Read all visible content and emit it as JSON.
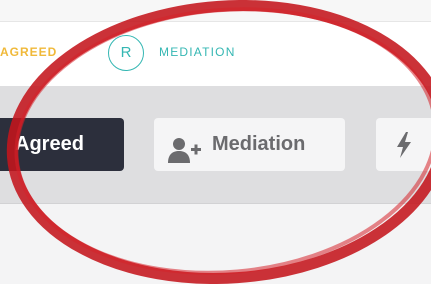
{
  "steps": {
    "agreed_label": "AGREED",
    "mediation_badge": "R",
    "mediation_label": "MEDIATION"
  },
  "actions": {
    "agreed_button": "Agreed",
    "mediation_button": "Mediation"
  },
  "icons": {
    "mediation": "add-user-icon",
    "bolt": "lightning-bolt-icon"
  },
  "colors": {
    "agreed_step": "#f0b93a",
    "mediation_step": "#35b7b3",
    "agreed_button_bg": "#2c2f3c",
    "annotation_circle": "#c4161c"
  }
}
